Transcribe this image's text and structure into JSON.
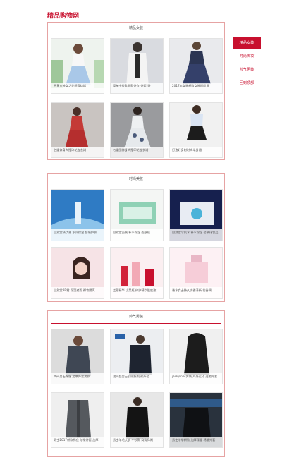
{
  "site": {
    "title": "精品购物网"
  },
  "sections": [
    {
      "title": "精品女装",
      "items": [
        {
          "caption": "贾黄女装女之花纸雪纺裙",
          "icon": "dress-photo-white-blue"
        },
        {
          "caption": "简单中长款配款外衣(外套)装",
          "icon": "dress-photo-white-coat"
        },
        {
          "caption": "2017年女装新款女装时尚复",
          "icon": "dress-photo-navy"
        },
        {
          "caption": "名媛修身大摆碎花连衣裙",
          "icon": "dress-photo-red-floral"
        },
        {
          "caption": "名媛图修身大摆印花连衣裙",
          "icon": "dress-photo-white-floral"
        },
        {
          "caption": "打造好身材时尚半身裙",
          "icon": "dress-photo-skirt"
        }
      ]
    },
    {
      "title": "时尚美妆",
      "items": [
        {
          "caption": "自然堂精华液 水润保湿 套装护肤",
          "icon": "cosmetic-photo-blue"
        },
        {
          "caption": "自然堂面膜 补水保湿 面膜贴",
          "icon": "cosmetic-photo-mask-box"
        },
        {
          "caption": "自然堂冰肌水 补水保湿 套装化妆品",
          "icon": "cosmetic-photo-dark-box"
        },
        {
          "caption": "自然堂BB霜 保湿遮瑕 裸妆隔离",
          "icon": "cosmetic-photo-model"
        },
        {
          "caption": "兰蔻精华 小黑瓶 修护精华肌底液",
          "icon": "cosmetic-photo-lancome"
        },
        {
          "caption": "香水女士持久淡香清新 花香调",
          "icon": "cosmetic-photo-perfume"
        }
      ]
    },
    {
      "title": "帅气男装",
      "items": [
        {
          "caption": "大码男士棉服 加厚外套男款",
          "icon": "menswear-photo-jacket"
        },
        {
          "caption": "波司登男士羽绒服 短款外套",
          "icon": "menswear-photo-down"
        },
        {
          "caption": "jackjones男装 户外运动 连帽外套",
          "icon": "menswear-photo-hoodie"
        },
        {
          "caption": "男士2017新款棉衣 冬季外套 加厚",
          "icon": "menswear-photo-parka"
        },
        {
          "caption": "男士羊毛大衣 中长款 商务休闲",
          "icon": "menswear-photo-coat"
        },
        {
          "caption": "男士冬季新款 加厚保暖 棉服外套",
          "icon": "menswear-photo-black"
        }
      ]
    }
  ],
  "nav": {
    "items": [
      {
        "label": "精品女装",
        "active": true
      },
      {
        "label": "时尚美妆",
        "active": false
      },
      {
        "label": "帅气男装",
        "active": false
      },
      {
        "label": "回到顶部",
        "active": false
      }
    ]
  },
  "colors": {
    "accent": "#c8102e",
    "border": "#e6a3a3"
  }
}
